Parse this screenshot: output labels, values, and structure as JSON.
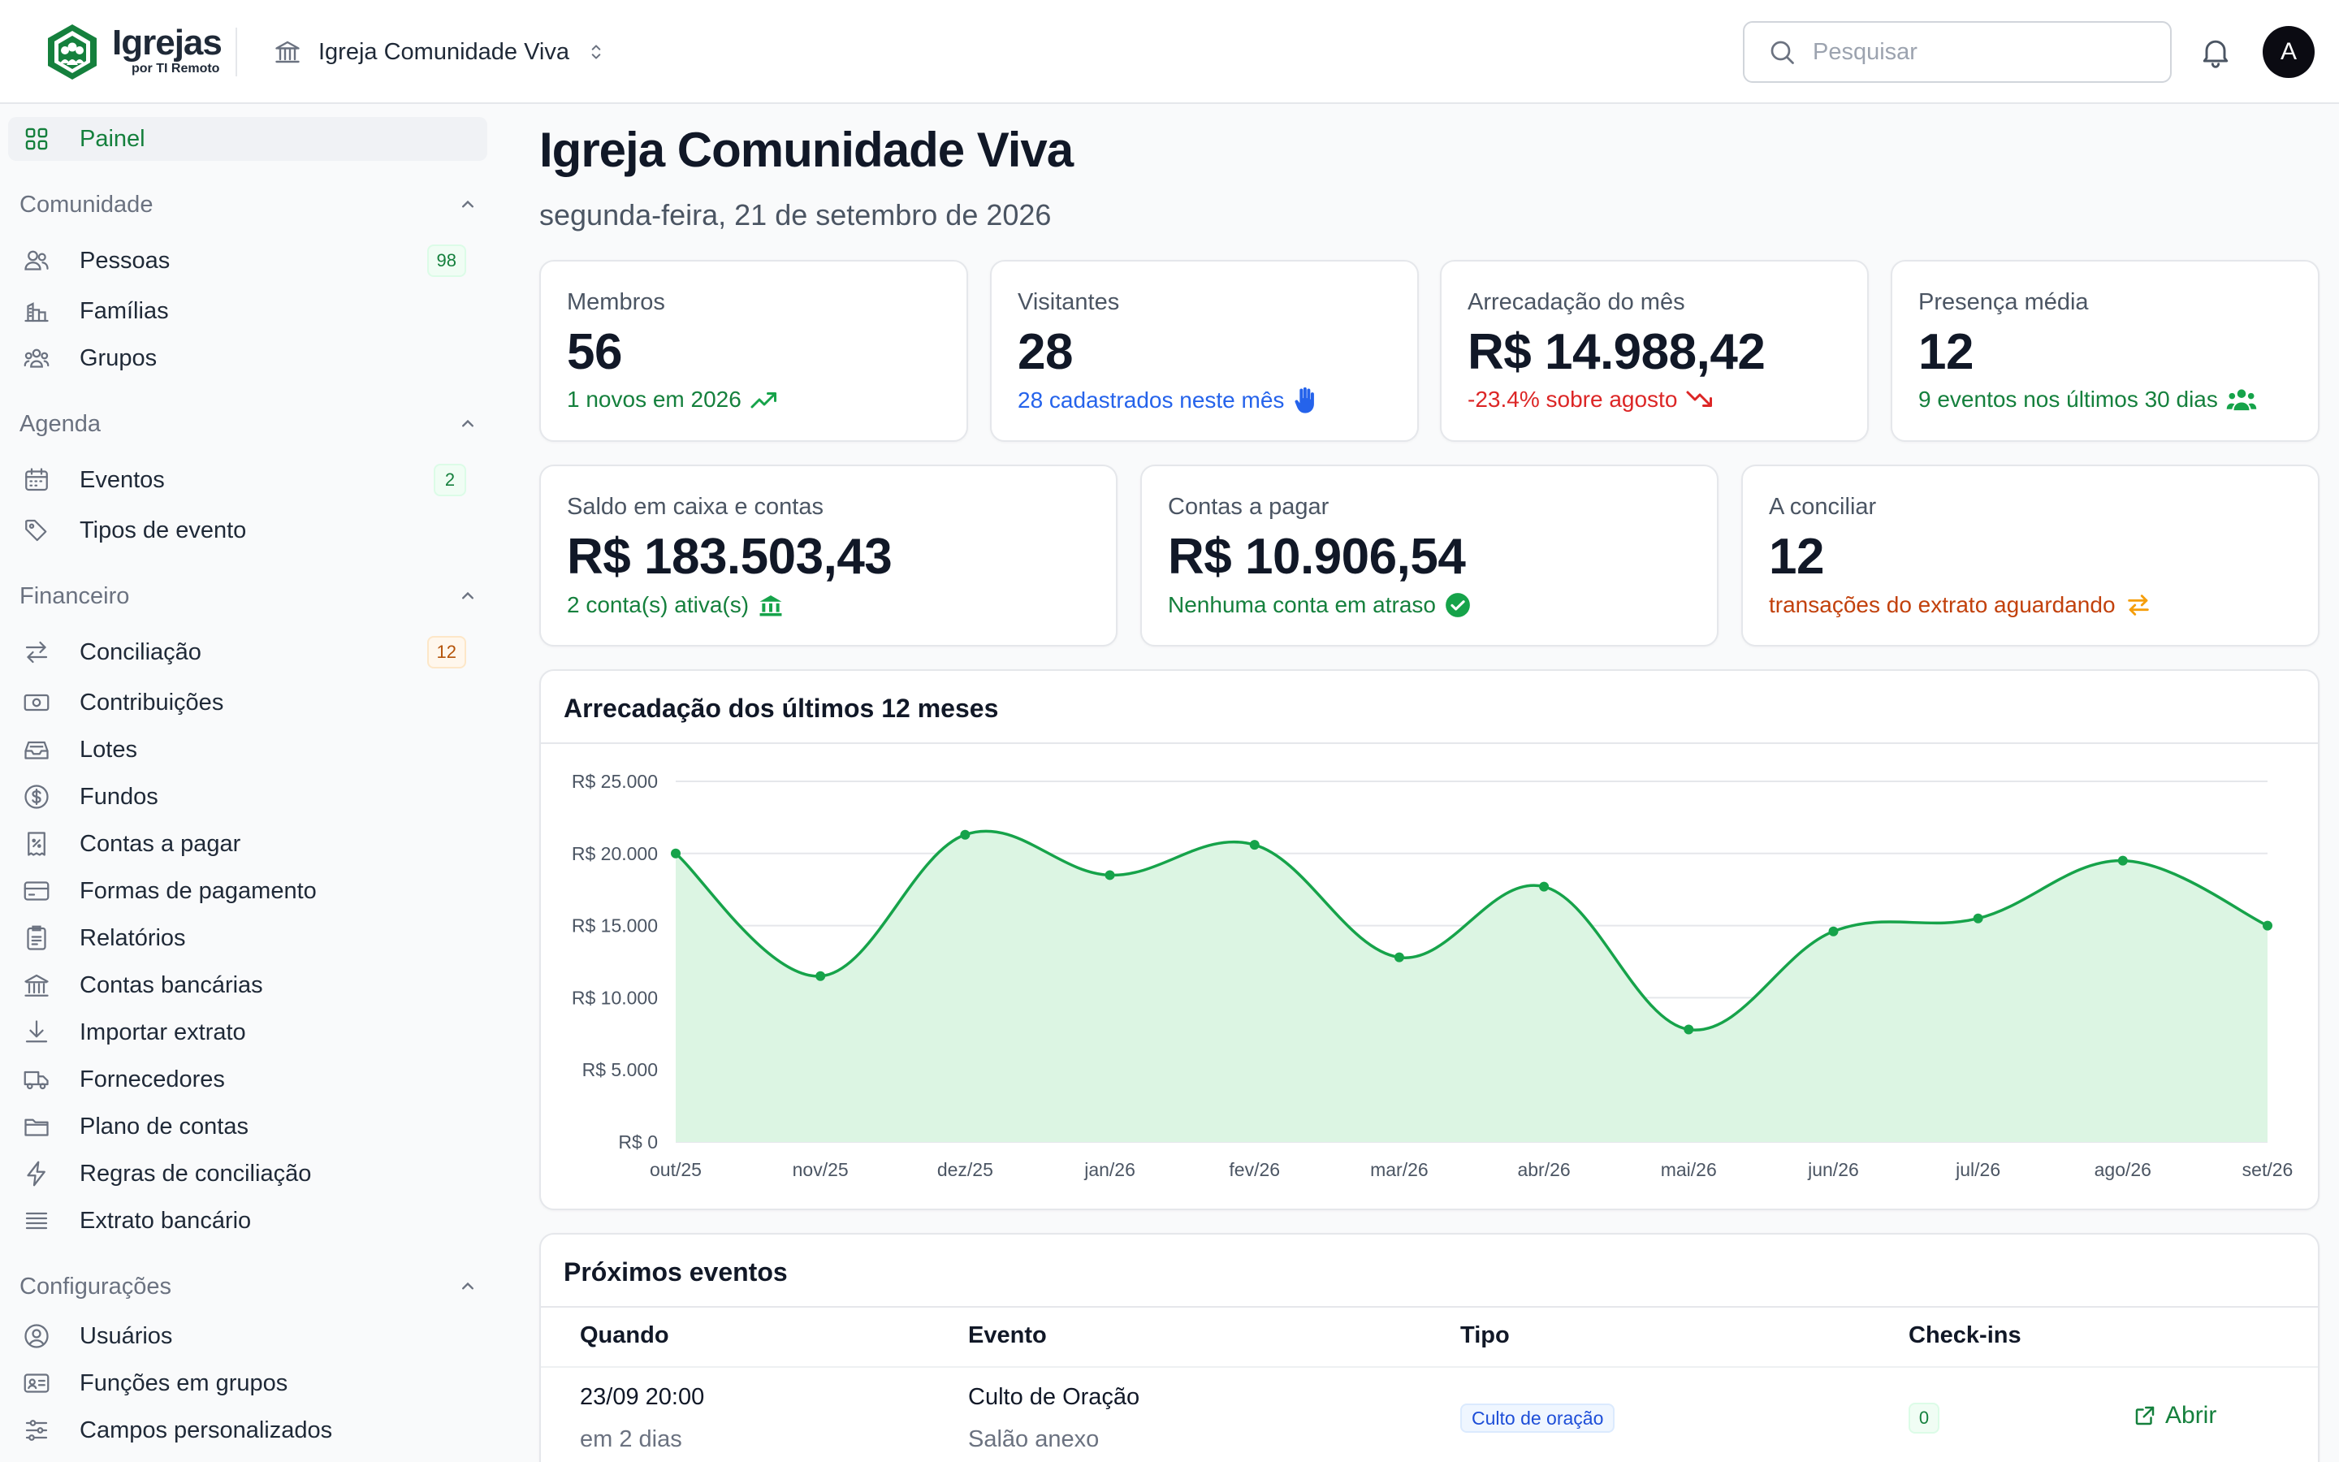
{
  "brand": {
    "name": "Igrejas",
    "sub": "por TI Remoto"
  },
  "church_select": {
    "name": "Igreja Comunidade Viva"
  },
  "search": {
    "placeholder": "Pesquisar"
  },
  "user": {
    "initial": "A"
  },
  "sidebar": {
    "painel": {
      "label": "Painel",
      "icon": "grid-icon"
    },
    "sections": {
      "comunidade": {
        "title": "Comunidade",
        "items": [
          {
            "label": "Pessoas",
            "icon": "users-icon",
            "badge": "98"
          },
          {
            "label": "Famílias",
            "icon": "family-icon"
          },
          {
            "label": "Grupos",
            "icon": "groups-icon"
          }
        ]
      },
      "agenda": {
        "title": "Agenda",
        "items": [
          {
            "label": "Eventos",
            "icon": "calendar-icon",
            "badge": "2"
          },
          {
            "label": "Tipos de evento",
            "icon": "tag-icon"
          }
        ]
      },
      "financeiro": {
        "title": "Financeiro",
        "items": [
          {
            "label": "Conciliação",
            "icon": "arrows-icon",
            "badge": "12"
          },
          {
            "label": "Contribuições",
            "icon": "banknote-icon"
          },
          {
            "label": "Lotes",
            "icon": "inbox-icon"
          },
          {
            "label": "Fundos",
            "icon": "dollar-icon"
          },
          {
            "label": "Contas a pagar",
            "icon": "receipt-icon"
          },
          {
            "label": "Formas de pagamento",
            "icon": "credit-card-icon"
          },
          {
            "label": "Relatórios",
            "icon": "report-icon"
          },
          {
            "label": "Contas bancárias",
            "icon": "bank-icon"
          },
          {
            "label": "Importar extrato",
            "icon": "download-icon"
          },
          {
            "label": "Fornecedores",
            "icon": "truck-icon"
          },
          {
            "label": "Plano de contas",
            "icon": "folder-icon"
          },
          {
            "label": "Regras de conciliação",
            "icon": "bolt-icon"
          },
          {
            "label": "Extrato bancário",
            "icon": "list-icon"
          }
        ]
      },
      "configuracoes": {
        "title": "Configurações",
        "items": [
          {
            "label": "Usuários",
            "icon": "user-circle-icon"
          },
          {
            "label": "Funções em grupos",
            "icon": "id-card-icon"
          },
          {
            "label": "Campos personalizados",
            "icon": "sliders-icon"
          }
        ]
      }
    }
  },
  "page": {
    "title": "Igreja Comunidade Viva",
    "date": "segunda-feira, 21 de setembro de 2026"
  },
  "stats_row1": [
    {
      "label": "Membros",
      "value": "56",
      "sub": "1 novos em 2026",
      "tone": "green",
      "icon": "trending-up-icon"
    },
    {
      "label": "Visitantes",
      "value": "28",
      "sub": "28 cadastrados neste mês",
      "tone": "blue",
      "icon": "hand-icon"
    },
    {
      "label": "Arrecadação do mês",
      "value": "R$ 14.988,42",
      "sub": "-23.4% sobre agosto",
      "tone": "red",
      "icon": "trending-down-icon"
    },
    {
      "label": "Presença média",
      "value": "12",
      "sub": "9 eventos nos últimos 30 dias",
      "tone": "green",
      "icon": "people-icon"
    }
  ],
  "stats_row2": [
    {
      "label": "Saldo em caixa e contas",
      "value": "R$ 183.503,43",
      "sub": "2 conta(s) ativa(s)",
      "tone": "green",
      "icon": "bank-icon"
    },
    {
      "label": "Contas a pagar",
      "value": "R$ 10.906,54",
      "sub": "Nenhuma conta em atraso",
      "tone": "green",
      "icon": "check-circle-icon"
    },
    {
      "label": "A conciliar",
      "value": "12",
      "sub": "transações do extrato aguardando",
      "tone": "orange",
      "icon": "swap-icon"
    }
  ],
  "colors": {
    "accent": "#16a34a",
    "accent_dark": "#15803d",
    "area_fill": "#dcf5e3",
    "blue": "#2563eb",
    "red": "#dc2626",
    "orange": "#c2410c"
  },
  "chart_panel": {
    "title": "Arrecadação dos últimos 12 meses"
  },
  "chart_data": {
    "type": "area",
    "title": "Arrecadação dos últimos 12 meses",
    "categories": [
      "out/25",
      "nov/25",
      "dez/25",
      "jan/26",
      "fev/26",
      "mar/26",
      "abr/26",
      "mai/26",
      "jun/26",
      "jul/26",
      "ago/26",
      "set/26"
    ],
    "series": [
      {
        "values": [
          20000,
          11500,
          21300,
          18500,
          20600,
          12800,
          17700,
          7800,
          14600,
          15500,
          19500,
          15000
        ]
      }
    ],
    "yticks": [
      "R$ 0",
      "R$ 5.000",
      "R$ 10.000",
      "R$ 15.000",
      "R$ 20.000",
      "R$ 25.000"
    ],
    "ylim": [
      0,
      25000
    ],
    "grid": true,
    "legend": "none"
  },
  "events": {
    "title": "Próximos eventos",
    "columns": {
      "when": "Quando",
      "event": "Evento",
      "type": "Tipo",
      "checkins": "Check-ins"
    },
    "rows": [
      {
        "when": "23/09 20:00",
        "relative": "em 2 dias",
        "event": "Culto de Oração",
        "place": "Salão anexo",
        "type": "Culto de oração",
        "checkins": "0",
        "action": "Abrir"
      }
    ]
  }
}
